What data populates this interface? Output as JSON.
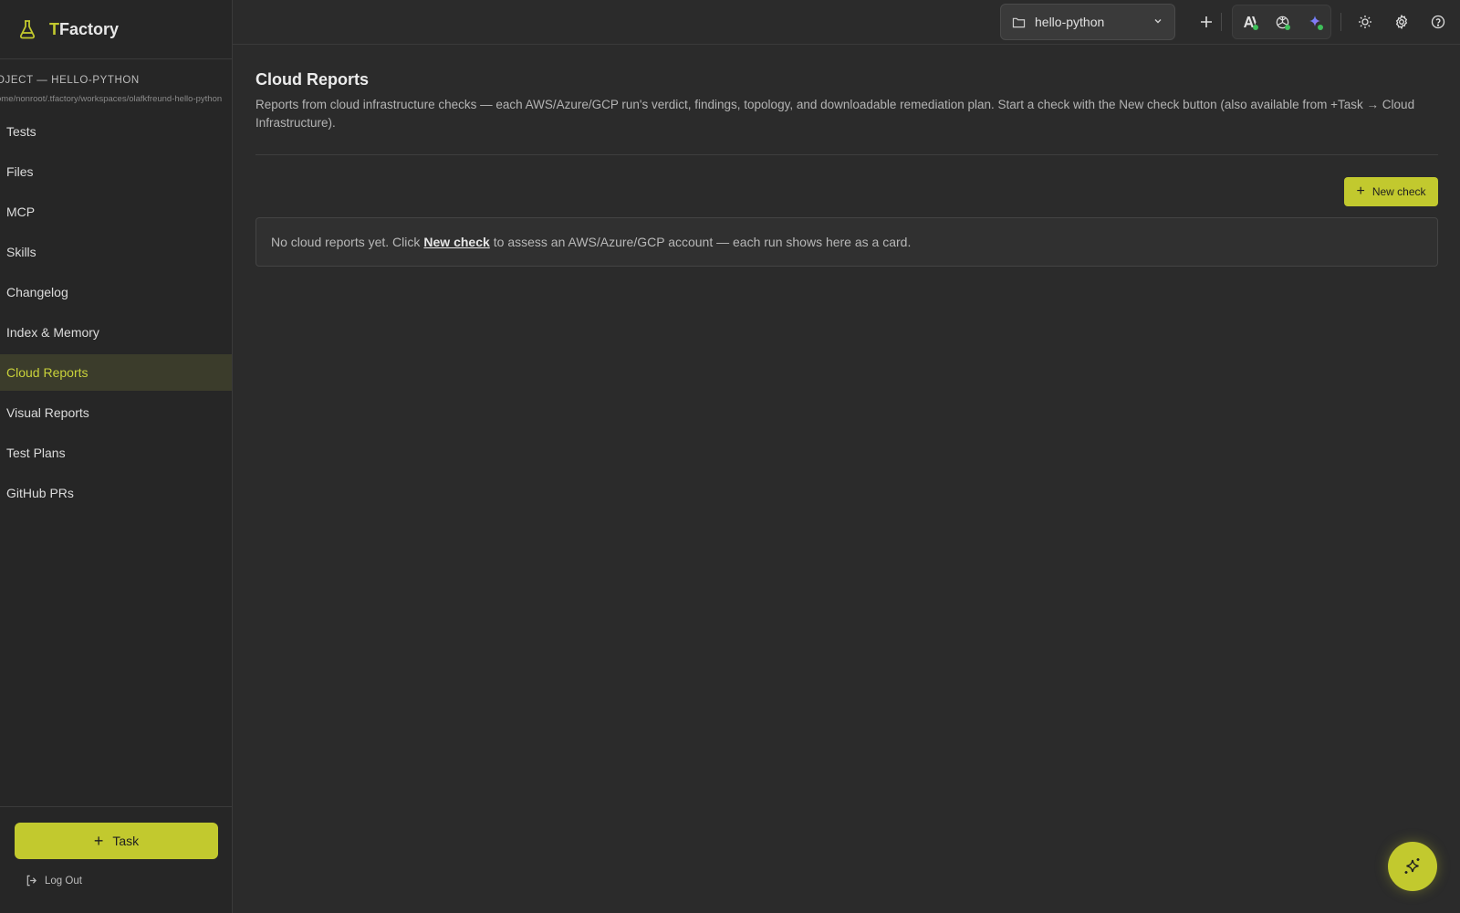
{
  "app": {
    "title_first": "T",
    "title_rest": "Factory"
  },
  "sidebar": {
    "project_label": "OJECT — HELLO-PYTHON",
    "project_path": "ome/nonroot/.tfactory/workspaces/olafkfreund-hello-python",
    "items": [
      {
        "label": "Tests",
        "active": false
      },
      {
        "label": "Files",
        "active": false
      },
      {
        "label": "MCP",
        "active": false
      },
      {
        "label": "Skills",
        "active": false
      },
      {
        "label": "Changelog",
        "active": false
      },
      {
        "label": "Index & Memory",
        "active": false
      },
      {
        "label": "Cloud Reports",
        "active": true
      },
      {
        "label": "Visual Reports",
        "active": false
      },
      {
        "label": "Test Plans",
        "active": false
      },
      {
        "label": "GitHub PRs",
        "active": false
      }
    ],
    "task_button": "Task",
    "logout": "Log Out"
  },
  "topbar": {
    "project_select": "hello-python",
    "icons": [
      "folder-icon",
      "chevron-down-icon",
      "plus-icon",
      "anthropic-icon",
      "openai-icon",
      "sparkle-icon",
      "sun-icon",
      "gear-icon",
      "help-icon"
    ]
  },
  "main": {
    "title": "Cloud Reports",
    "description": "Reports from cloud infrastructure checks — each AWS/Azure/GCP run's verdict, findings, topology, and downloadable remediation plan. Start a check with the New check button (also available from +Task → Cloud Infrastructure).",
    "new_check_button": "New check",
    "empty_prefix": "No cloud reports yet. Click",
    "empty_link": "New check",
    "empty_suffix": "to assess an AWS/Azure/GCP account — each run shows here as a card."
  },
  "colors": {
    "accent": "#c2c92e",
    "background": "#2b2b2b",
    "sidebar": "#262626",
    "active_bg": "#3b3c2b",
    "status_dot": "#3fbf5a"
  }
}
